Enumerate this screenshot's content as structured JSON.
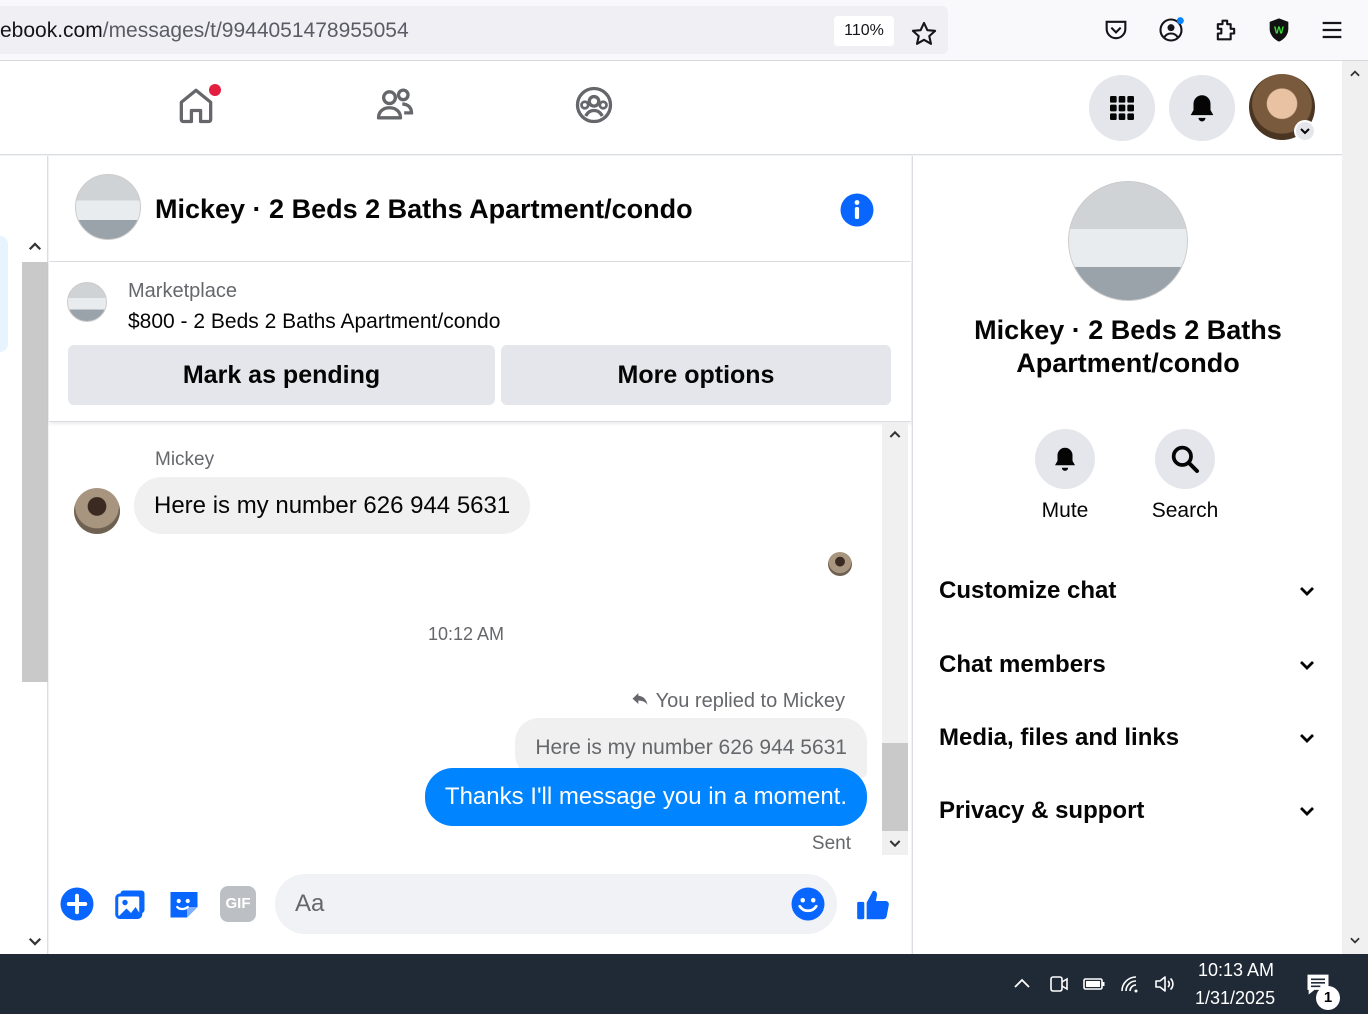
{
  "browser": {
    "url_domain": "ebook.com",
    "url_path": "/messages/t/9944051478955054",
    "zoom": "110%"
  },
  "chat": {
    "title": "Mickey · 2 Beds 2 Baths Apartment/condo",
    "marketplace_label": "Marketplace",
    "listing": "$800 - 2 Beds 2 Baths Apartment/condo",
    "mark_pending": "Mark as pending",
    "more_options": "More options"
  },
  "thread": {
    "sender": "Mickey",
    "incoming": "Here is my number 626 944 5631",
    "timestamp": "10:12 AM",
    "replied_label": "You replied to Mickey",
    "quoted": "Here is my number 626 944 5631",
    "outgoing": "Thanks I'll message you in a moment.",
    "status": "Sent"
  },
  "composer": {
    "placeholder": "Aa",
    "gif_label": "GIF"
  },
  "sidebar": {
    "title_line1": "Mickey · 2 Beds 2 Baths",
    "title_line2": "Apartment/condo",
    "mute": "Mute",
    "search": "Search",
    "sections": [
      "Customize chat",
      "Chat members",
      "Media, files and links",
      "Privacy & support"
    ]
  },
  "taskbar": {
    "time": "10:13 AM",
    "date": "1/31/2025",
    "notifications": "1"
  },
  "colors": {
    "fb_blue": "#0084ff",
    "notification_red": "#e41e3f"
  }
}
